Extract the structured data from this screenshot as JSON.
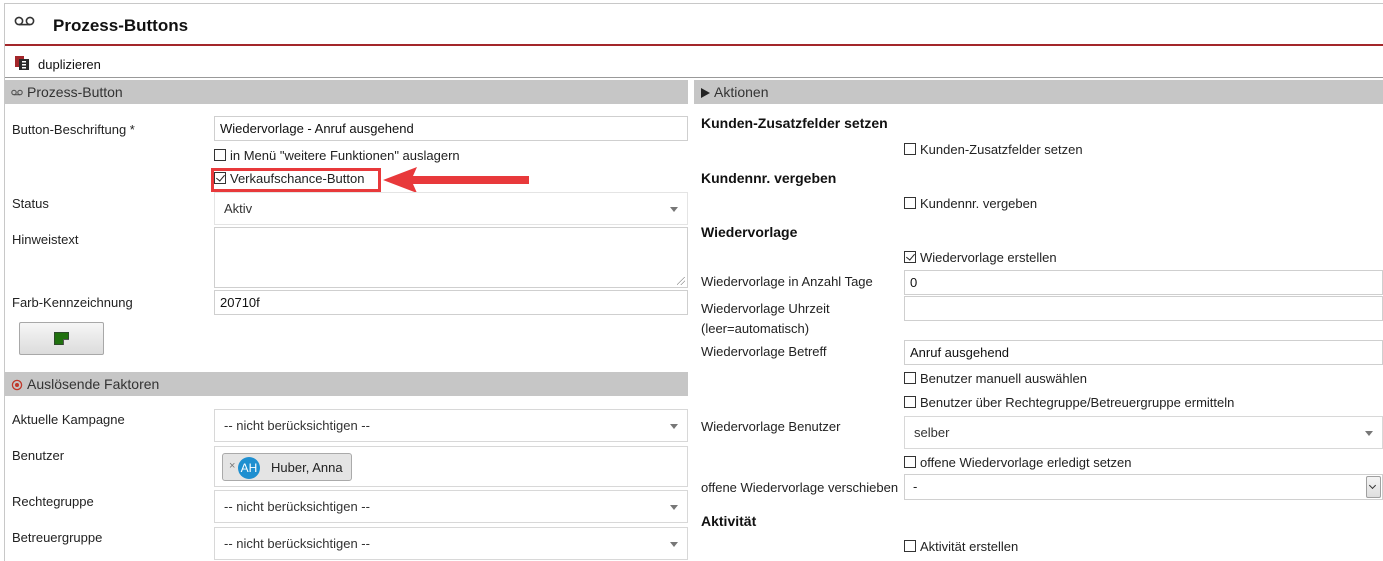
{
  "window": {
    "title": "Prozess-Buttons",
    "title_icon": "voicemail-icon"
  },
  "toolbar": {
    "duplicate_label": "duplizieren",
    "duplicate_icon": "duplicate-icon"
  },
  "left": {
    "process_button": {
      "header": "Prozess-Button",
      "label_caption": "Button-Beschriftung *",
      "caption_value": "Wiedervorlage - Anruf ausgehend",
      "menu_checkbox_label": "in Menü \"weitere Funktionen\" auslagern",
      "menu_checkbox_checked": false,
      "opportunity_checkbox_label": "Verkaufschance-Button",
      "opportunity_checkbox_checked": true,
      "status_label": "Status",
      "status_value": "Aktiv",
      "hint_label": "Hinweistext",
      "hint_value": "",
      "color_label": "Farb-Kennzeichnung",
      "color_value": "20710f",
      "color_hex": "#20710f"
    },
    "triggers": {
      "header": "Auslösende Faktoren",
      "campaign_label": "Aktuelle Kampagne",
      "campaign_value": "-- nicht berücksichtigen --",
      "user_label": "Benutzer",
      "user_tag_initials": "AH",
      "user_tag_name": "Huber, Anna",
      "user_tag_remove": "×",
      "rights_label": "Rechtegruppe",
      "rights_value": "-- nicht berücksichtigen --",
      "advisor_label": "Betreuergruppe",
      "advisor_value": "-- nicht berücksichtigen --"
    }
  },
  "right": {
    "header": "Aktionen",
    "customer_fields": {
      "title": "Kunden-Zusatzfelder setzen",
      "checkbox_label": "Kunden-Zusatzfelder setzen",
      "checked": false
    },
    "customer_number": {
      "title": "Kundennr. vergeben",
      "checkbox_label": "Kundennr. vergeben",
      "checked": false
    },
    "followup": {
      "title": "Wiedervorlage",
      "create_label": "Wiedervorlage erstellen",
      "create_checked": true,
      "days_label": "Wiedervorlage in Anzahl Tage",
      "days_value": "0",
      "time_label_1": "Wiedervorlage Uhrzeit",
      "time_label_2": "(leer=automatisch)",
      "time_value": "",
      "subject_label": "Wiedervorlage Betreff",
      "subject_value": "Anruf ausgehend",
      "manual_user_label": "Benutzer manuell auswählen",
      "manual_user_checked": false,
      "group_user_label": "Benutzer über Rechtegruppe/Betreuergruppe ermitteln",
      "group_user_checked": false,
      "user_label": "Wiedervorlage Benutzer",
      "user_value": "selber",
      "done_label": "offene Wiedervorlage erledigt setzen",
      "done_checked": false,
      "move_label": "offene Wiedervorlage verschieben",
      "move_value": "-"
    },
    "activity": {
      "title": "Aktivität",
      "create_label": "Aktivität erstellen",
      "create_checked": false
    }
  },
  "colors": {
    "accent_red": "#a3262a",
    "highlight_red": "#e8393b",
    "section_grey": "#c6c6c6",
    "avatar_blue": "#1e8fd0"
  }
}
